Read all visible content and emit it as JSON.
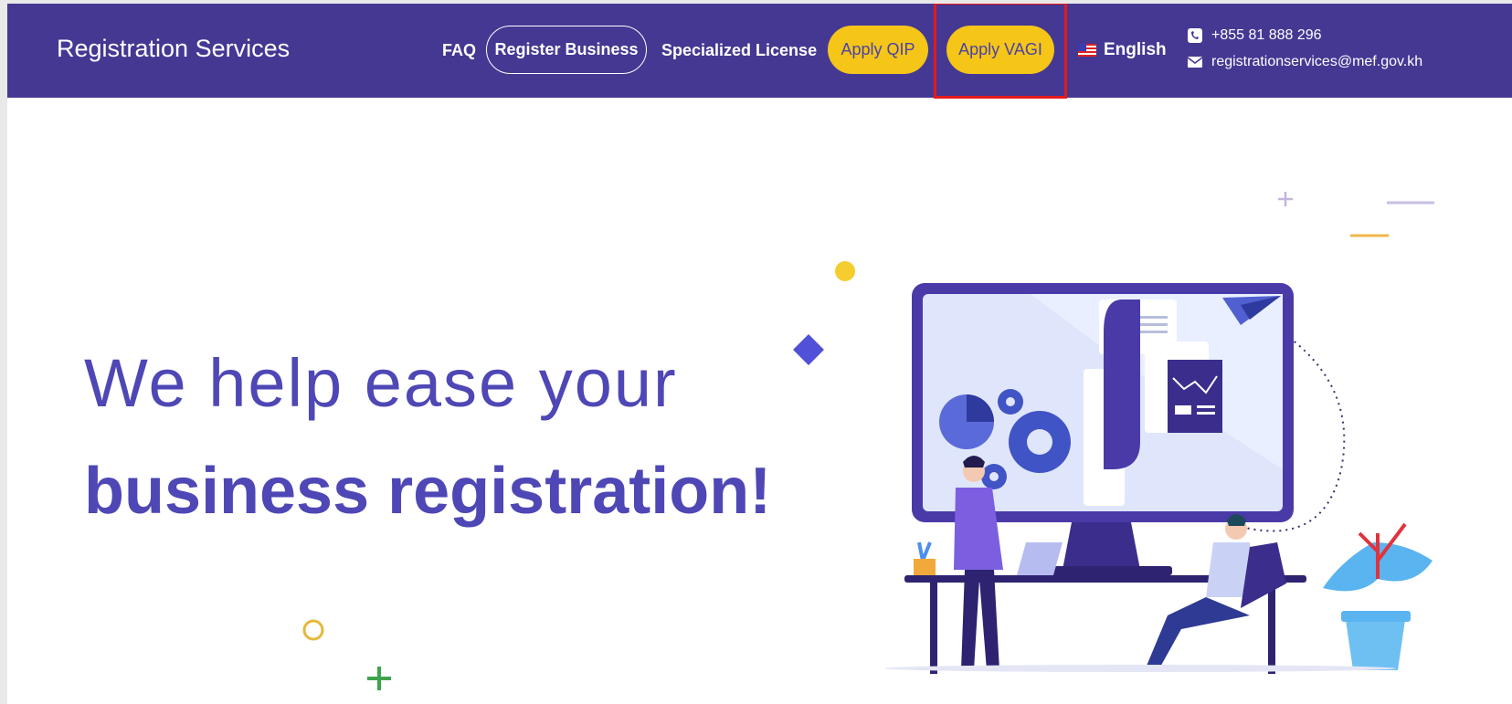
{
  "header": {
    "brand": "Registration Services",
    "nav": {
      "faq": "FAQ",
      "register_business": "Register Business",
      "specialized_license": "Specialized License",
      "apply_qip": "Apply QIP",
      "apply_vagi": "Apply VAGI"
    },
    "language": "English",
    "phone": "+855 81 888 296",
    "email": "registrationservices@mef.gov.kh"
  },
  "hero": {
    "line1": "We help ease your",
    "line2": "business registration!"
  },
  "colors": {
    "header_bg": "#443893",
    "accent_yellow": "#f5c518",
    "hero_text": "#4e47b5",
    "highlight": "#e5191a"
  }
}
